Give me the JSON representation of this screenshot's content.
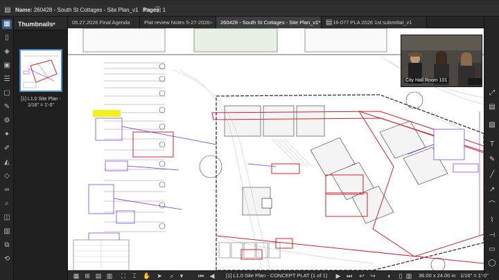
{
  "app": {
    "document_label": "Name:",
    "document_name": "260428 - South St Cottages - Site Plan_v1",
    "pages_label": "Pages:",
    "pages_count": "1"
  },
  "thumbnails": {
    "title": "Thumbnails",
    "caption": "[1] L1.0 Site Plan - 1/16\" = 1'-0\""
  },
  "tabs": [
    {
      "label": "05.27.2026 Final Agenda"
    },
    {
      "label": "Plat review Notes 5-27-2026"
    },
    {
      "label": "260428 - South St Cottages - Site Plan_v1*"
    },
    {
      "label": "16-077 PLA 2026 1st submittal_v1"
    }
  ],
  "video": {
    "label": "City Hall Room 101"
  },
  "status": {
    "page_indicator": "[1] L1.0 Site Plan - CONCEPT PLAT (1 of 1)",
    "dimensions": "36.00 x 24.00 in",
    "scale": "1/16\" = 1'-0\""
  },
  "colors": {
    "accent": "#4a8bd6",
    "markup_red": "#d0202a",
    "markup_purple": "#6a2bd8",
    "highlight_yellow": "#f3f020"
  }
}
